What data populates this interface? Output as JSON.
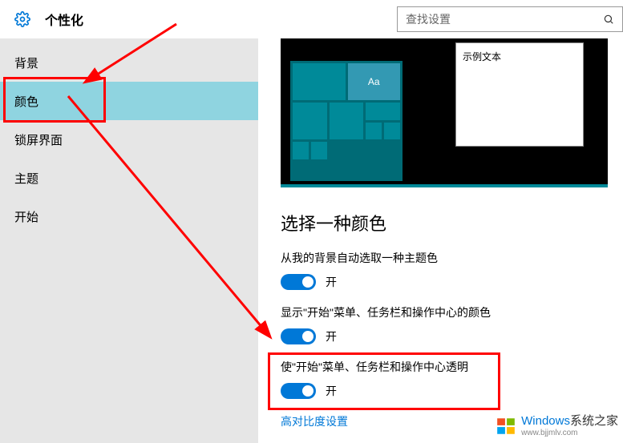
{
  "header": {
    "title": "个性化",
    "search_placeholder": "查找设置"
  },
  "sidebar": {
    "items": [
      {
        "label": "背景"
      },
      {
        "label": "颜色"
      },
      {
        "label": "锁屏界面"
      },
      {
        "label": "主题"
      },
      {
        "label": "开始"
      }
    ]
  },
  "preview": {
    "sample_text": "示例文本",
    "tile_label": "Aa"
  },
  "content": {
    "section_heading": "选择一种颜色",
    "auto_pick": {
      "label": "从我的背景自动选取一种主题色",
      "state": "开"
    },
    "show_start_color": {
      "label": "显示\"开始\"菜单、任务栏和操作中心的颜色",
      "state": "开"
    },
    "transparency": {
      "label": "使\"开始\"菜单、任务栏和操作中心透明",
      "state": "开"
    },
    "high_contrast_link": "高对比度设置"
  },
  "toggle": {
    "accent_color": "#0078d7"
  },
  "watermark": {
    "brand": "Windows",
    "suffix": "系统之家",
    "url": "www.bjjmlv.com"
  }
}
